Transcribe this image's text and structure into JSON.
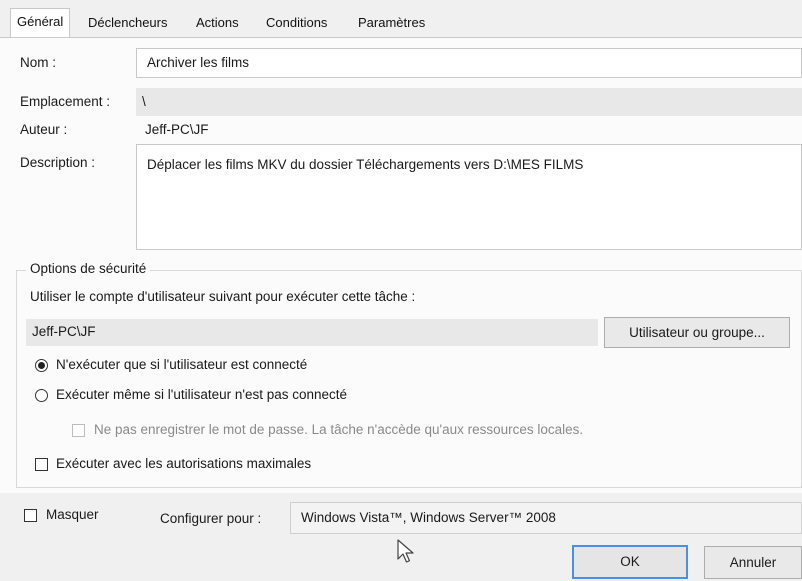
{
  "tabs": [
    {
      "label": "Général",
      "active": true
    },
    {
      "label": "Déclencheurs",
      "active": false
    },
    {
      "label": "Actions",
      "active": false
    },
    {
      "label": "Conditions",
      "active": false
    },
    {
      "label": "Paramètres",
      "active": false
    }
  ],
  "general": {
    "name_label": "Nom :",
    "name_value": "Archiver les films",
    "location_label": "Emplacement :",
    "location_value": "\\",
    "author_label": "Auteur :",
    "author_value": "Jeff-PC\\JF",
    "description_label": "Description :",
    "description_value": "Déplacer les films MKV du dossier Téléchargements vers D:\\MES FILMS"
  },
  "security": {
    "group_title": "Options de sécurité",
    "account_prompt": "Utiliser le compte d'utilisateur suivant pour exécuter cette tâche :",
    "account_value": "Jeff-PC\\JF",
    "user_group_button": "Utilisateur ou groupe...",
    "radio_logged_on": "N'exécuter que si l'utilisateur est connecté",
    "radio_logged_on_selected": true,
    "radio_any": "Exécuter même si l'utilisateur n'est pas connecté",
    "radio_any_selected": false,
    "no_store_password": "Ne pas enregistrer le mot de passe. La tâche n'accède qu'aux ressources locales.",
    "highest_privileges": "Exécuter avec les autorisations maximales"
  },
  "footer": {
    "hidden_label": "Masquer",
    "configure_label": "Configurer pour :",
    "configure_value": "Windows Vista™, Windows Server™ 2008",
    "ok_button": "OK",
    "cancel_button": "Annuler"
  },
  "icons": {
    "pointer": "mouse-pointer-icon"
  },
  "colors": {
    "focus_border": "#4a8ee6"
  }
}
